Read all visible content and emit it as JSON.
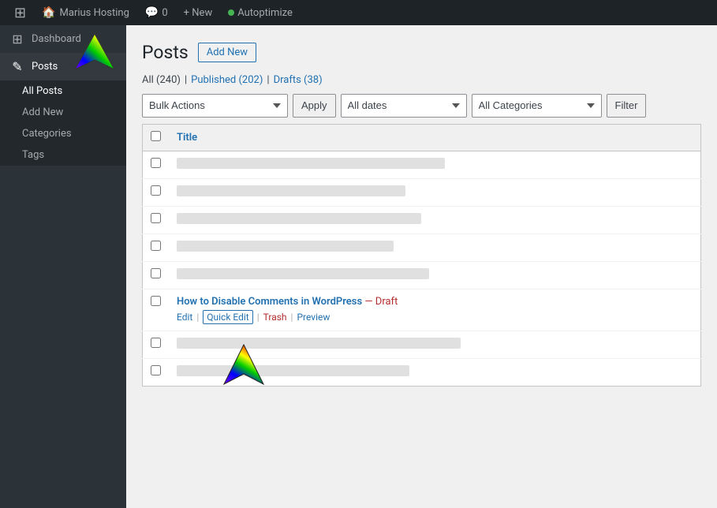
{
  "adminbar": {
    "wp_icon": "⊞",
    "site_name": "Marius Hosting",
    "comments_label": "Comments",
    "comments_count": "0",
    "new_label": "+ New",
    "autoptimize_label": "Autoptimize"
  },
  "sidebar": {
    "dashboard_label": "Dashboard",
    "posts_label": "Posts",
    "all_posts_label": "All Posts",
    "add_new_label": "Add New",
    "categories_label": "Categories",
    "tags_label": "Tags"
  },
  "page": {
    "title": "Posts",
    "add_new_btn": "Add New"
  },
  "subsubsub": {
    "all_label": "All",
    "all_count": "(240)",
    "published_label": "Published",
    "published_count": "(202)",
    "drafts_label": "Drafts",
    "drafts_count": "(38)"
  },
  "toolbar": {
    "bulk_actions_label": "Bulk Actions",
    "apply_label": "Apply",
    "all_dates_label": "All dates",
    "all_categories_label": "All Categories",
    "filter_label": "Filter"
  },
  "table": {
    "title_col": "Title"
  },
  "posts": [
    {
      "id": 1,
      "placeholder_width": "340",
      "has_content": false
    },
    {
      "id": 2,
      "placeholder_width": "290",
      "has_content": false
    },
    {
      "id": 3,
      "placeholder_width": "310",
      "has_content": false
    },
    {
      "id": 4,
      "placeholder_width": "275",
      "has_content": false
    },
    {
      "id": 5,
      "placeholder_width": "320",
      "has_content": false
    },
    {
      "id": 6,
      "has_content": true,
      "title": "How to Disable Comments in WordPress",
      "status": "Draft",
      "edit_label": "Edit",
      "quick_edit_label": "Quick Edit",
      "trash_label": "Trash",
      "preview_label": "Preview"
    },
    {
      "id": 7,
      "placeholder_width": "360",
      "has_content": false
    },
    {
      "id": 8,
      "placeholder_width": "295",
      "has_content": false
    }
  ]
}
